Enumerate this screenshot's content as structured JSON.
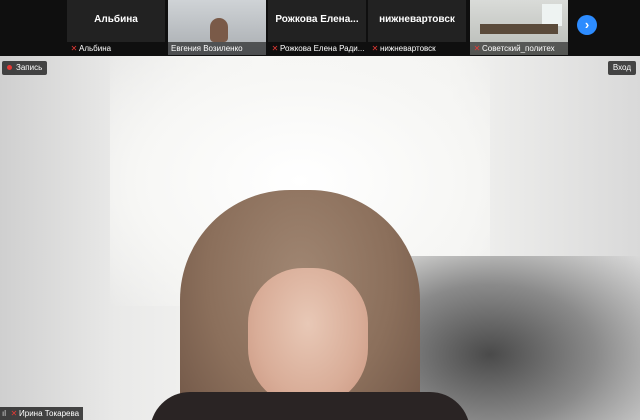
{
  "participants": [
    {
      "label": "Альбина",
      "caption": "Альбина"
    },
    {
      "label": "",
      "caption": "Евгения Возиленко"
    },
    {
      "label": "Рожкова Елена...",
      "caption": "Рожкова Елена Ради..."
    },
    {
      "label": "нижневартовск",
      "caption": "нижневартовск"
    },
    {
      "label": "",
      "caption": "Советский_политех"
    }
  ],
  "controls": {
    "record_label": "Запись",
    "enter_label": "Вход",
    "next_icon": "chevron-right-icon"
  },
  "speaker": {
    "name": "Ирина Токарева"
  },
  "colors": {
    "accent": "#2d8cff",
    "muted_mic": "#e53935"
  }
}
